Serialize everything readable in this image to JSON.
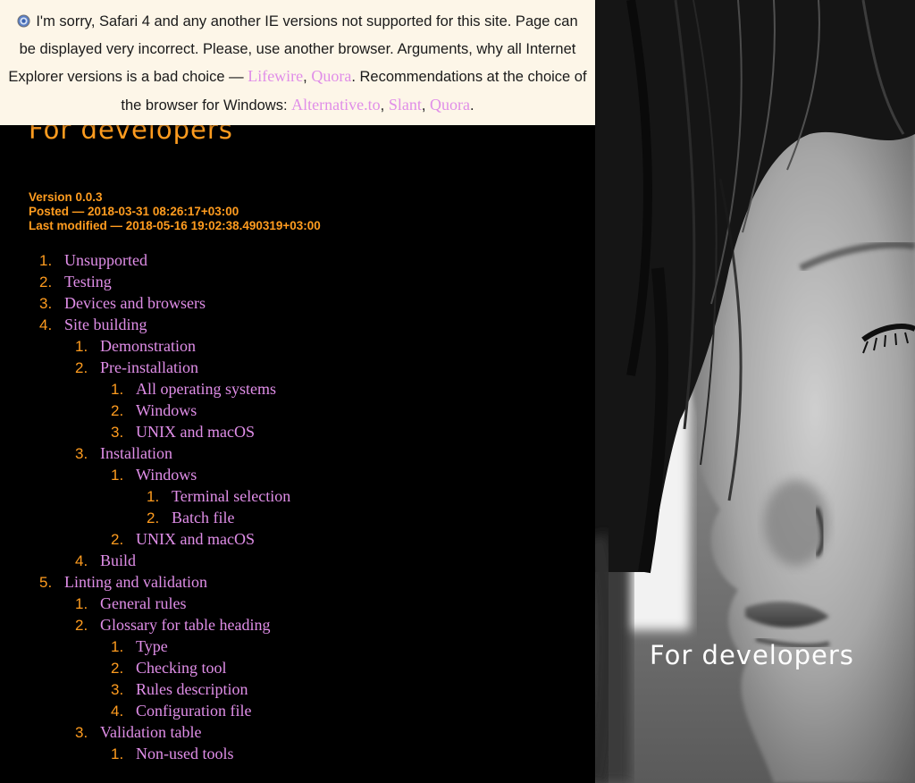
{
  "banner": {
    "icon": "browser-globe-icon",
    "text_1": "I'm sorry, Safari 4 and any another IE versions not supported for this site. Page can be displayed very incorrect. Please, use another browser. Arguments, why all Internet Explorer versions is a bad choice —",
    "link_lifewire": "Lifewire",
    "sep_1": ",",
    "link_quora_1": "Quora",
    "text_2": ". Recommendations at the choice of the browser for Windows:",
    "link_alternativeto": "Alternative.to",
    "sep_2": ",",
    "link_slant": "Slant",
    "sep_3": ",",
    "link_quora_2": "Quora",
    "text_end": "."
  },
  "header": {
    "title": "For developers"
  },
  "meta": {
    "version": "Version 0.0.3",
    "posted": "Posted — 2018-03-31 08:26:17+03:00",
    "modified": "Last modified — 2018-05-16 19:02:38.490319+03:00"
  },
  "toc": [
    {
      "num": "1.",
      "label": "Unsupported"
    },
    {
      "num": "2.",
      "label": "Testing"
    },
    {
      "num": "3.",
      "label": "Devices and browsers"
    },
    {
      "num": "4.",
      "label": "Site building",
      "children": [
        {
          "num": "1.",
          "label": "Demonstration"
        },
        {
          "num": "2.",
          "label": "Pre-installation",
          "children": [
            {
              "num": "1.",
              "label": "All operating systems"
            },
            {
              "num": "2.",
              "label": "Windows"
            },
            {
              "num": "3.",
              "label": "UNIX and macOS"
            }
          ]
        },
        {
          "num": "3.",
          "label": "Installation",
          "children": [
            {
              "num": "1.",
              "label": "Windows",
              "children": [
                {
                  "num": "1.",
                  "label": "Terminal selection"
                },
                {
                  "num": "2.",
                  "label": "Batch file"
                }
              ]
            },
            {
              "num": "2.",
              "label": "UNIX and macOS"
            }
          ]
        },
        {
          "num": "4.",
          "label": "Build"
        }
      ]
    },
    {
      "num": "5.",
      "label": "Linting and validation",
      "children": [
        {
          "num": "1.",
          "label": "General rules"
        },
        {
          "num": "2.",
          "label": "Glossary for table heading",
          "children": [
            {
              "num": "1.",
              "label": "Type"
            },
            {
              "num": "2.",
              "label": "Checking tool"
            },
            {
              "num": "3.",
              "label": "Rules description"
            },
            {
              "num": "4.",
              "label": "Configuration file"
            }
          ]
        },
        {
          "num": "3.",
          "label": "Validation table",
          "children": [
            {
              "num": "1.",
              "label": "Non-used tools"
            }
          ]
        }
      ]
    }
  ],
  "hero": {
    "title": "For developers",
    "image": "black-and-white-portrait-photo"
  },
  "colors": {
    "background": "#000000",
    "accent_orange": "#ff9c1f",
    "link_pink": "#e08ee8",
    "banner_bg": "#fdf6e8"
  }
}
